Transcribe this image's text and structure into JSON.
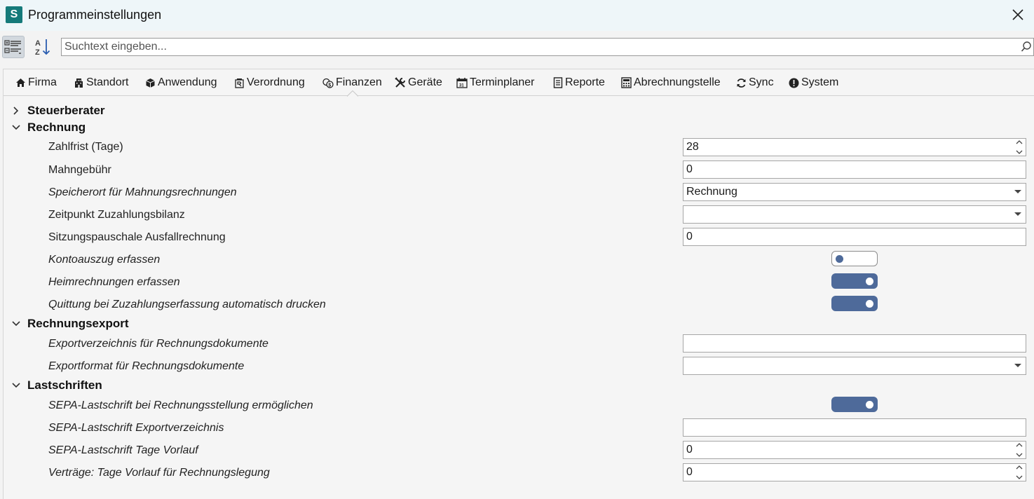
{
  "window": {
    "logo_letter": "S",
    "title": "Programmeinstellungen"
  },
  "toolbar": {
    "search_placeholder": "Suchtext eingeben..."
  },
  "tabs": [
    {
      "label": "Firma",
      "icon": "home-icon"
    },
    {
      "label": "Standort",
      "icon": "building-icon"
    },
    {
      "label": "Anwendung",
      "icon": "cube-icon"
    },
    {
      "label": "Verordnung",
      "icon": "prescription-icon"
    },
    {
      "label": "Finanzen",
      "icon": "coins-icon",
      "active": true
    },
    {
      "label": "Geräte",
      "icon": "tools-icon"
    },
    {
      "label": "Terminplaner",
      "icon": "calendar-icon"
    },
    {
      "label": "Reporte",
      "icon": "document-icon"
    },
    {
      "label": "Abrechnungstelle",
      "icon": "calculator-icon"
    },
    {
      "label": "Sync",
      "icon": "sync-icon"
    },
    {
      "label": "System",
      "icon": "alert-circle-icon"
    }
  ],
  "groups": {
    "steuerberater": {
      "label": "Steuerberater",
      "expanded": false
    },
    "rechnung": {
      "label": "Rechnung",
      "expanded": true
    },
    "rechnungsexport": {
      "label": "Rechnungsexport",
      "expanded": true
    },
    "lastschriften": {
      "label": "Lastschriften",
      "expanded": true
    }
  },
  "settings": {
    "zahlfrist": {
      "label": "Zahlfrist (Tage)",
      "value": "28"
    },
    "mahngebuehr": {
      "label": "Mahngebühr",
      "value": "0"
    },
    "speicherort": {
      "label": "Speicherort für Mahnungsrechnungen",
      "value": "Rechnung"
    },
    "zeitpunkt": {
      "label": "Zeitpunkt Zuzahlungsbilanz",
      "value": ""
    },
    "sitzungspauschale": {
      "label": "Sitzungspauschale Ausfallrechnung",
      "value": "0"
    },
    "kontoauszug": {
      "label": "Kontoauszug erfassen",
      "on": false
    },
    "heimrechnungen": {
      "label": "Heimrechnungen erfassen",
      "on": true
    },
    "quittung": {
      "label": "Quittung bei Zuzahlungserfassung automatisch drucken",
      "on": true
    },
    "exportverzeichnis": {
      "label": "Exportverzeichnis für Rechnungsdokumente",
      "value": ""
    },
    "exportformat": {
      "label": "Exportformat für Rechnungsdokumente",
      "value": ""
    },
    "sepa_ermoeglichen": {
      "label": "SEPA-Lastschrift bei Rechnungsstellung ermöglichen",
      "on": true
    },
    "sepa_export": {
      "label": "SEPA-Lastschrift Exportverzeichnis",
      "value": ""
    },
    "sepa_tage": {
      "label": "SEPA-Lastschrift Tage Vorlauf",
      "value": "0"
    },
    "vertraege_tage": {
      "label": "Verträge: Tage Vorlauf für Rechnungslegung",
      "value": "0"
    }
  },
  "colors": {
    "accent": "#4e6a9a",
    "logo": "#157a7a"
  }
}
